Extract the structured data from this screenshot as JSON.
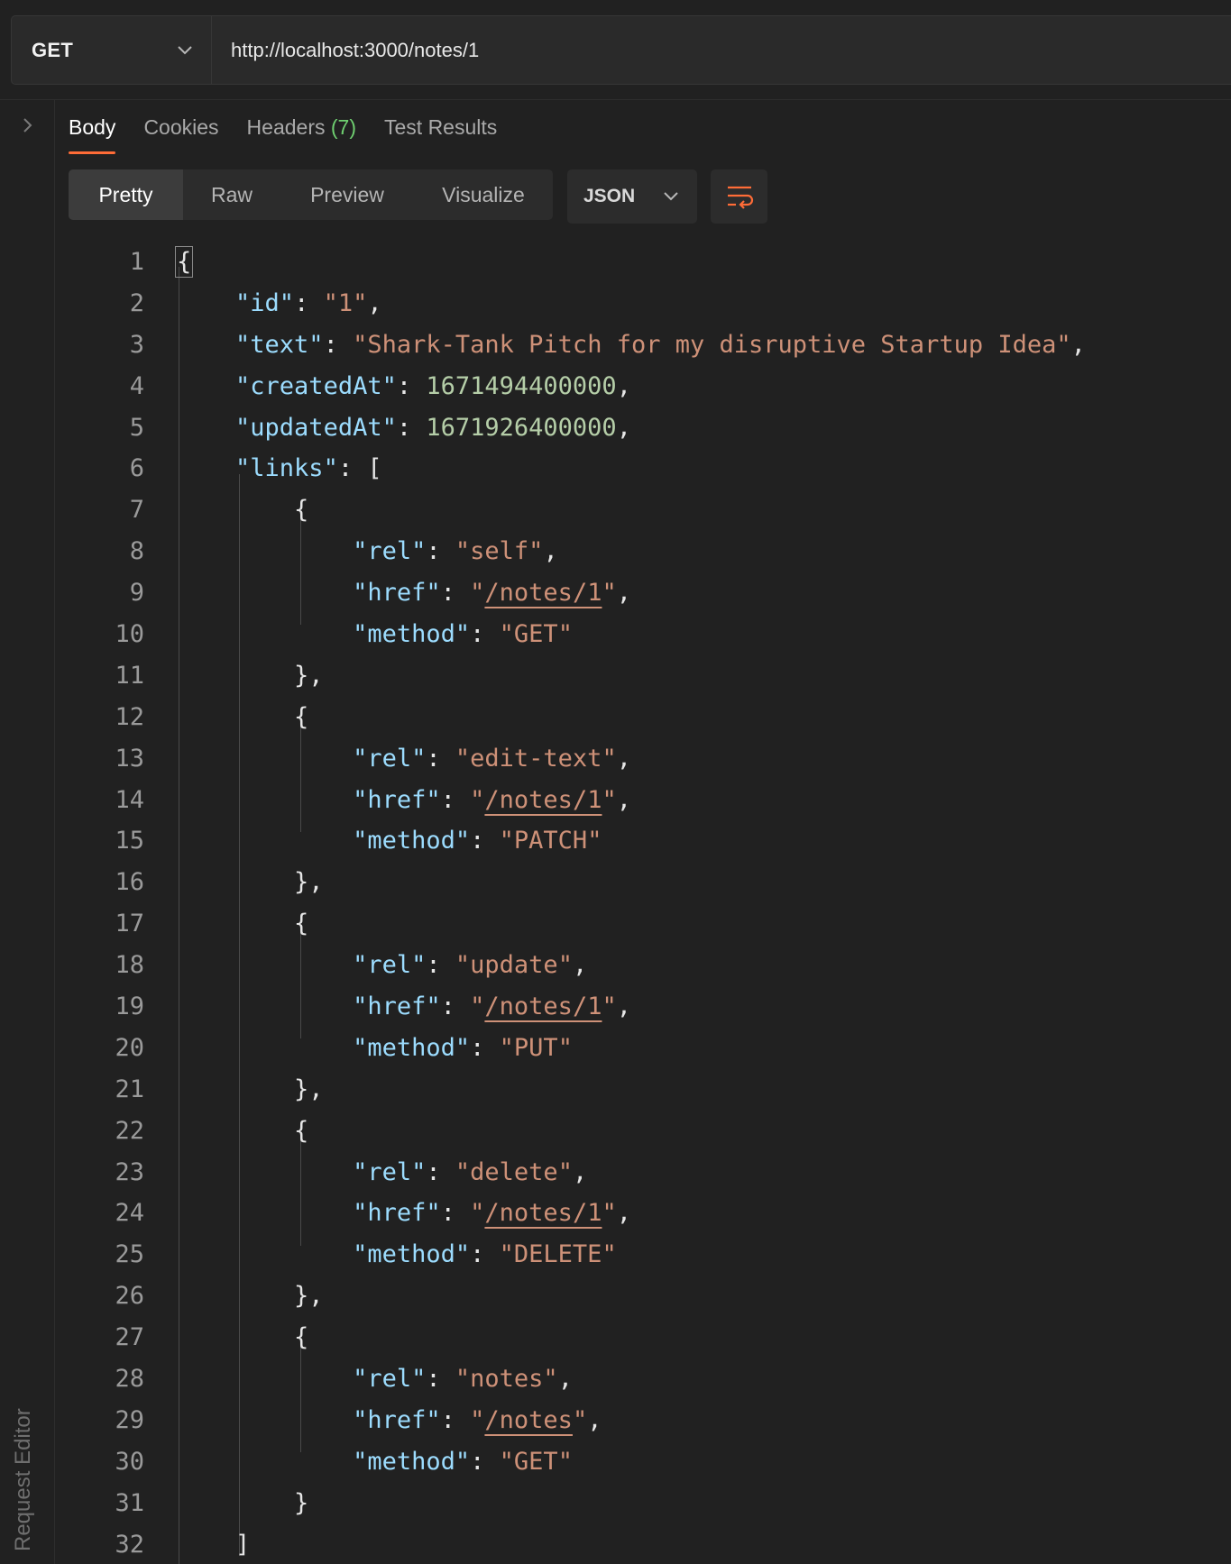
{
  "request": {
    "method": "GET",
    "url": "http://localhost:3000/notes/1"
  },
  "sidebar": {
    "label": "Request Editor"
  },
  "response_tabs": [
    {
      "label": "Body",
      "active": true
    },
    {
      "label": "Cookies"
    },
    {
      "label": "Headers",
      "count": "(7)"
    },
    {
      "label": "Test Results"
    }
  ],
  "view_modes": [
    "Pretty",
    "Raw",
    "Preview",
    "Visualize"
  ],
  "active_view": "Pretty",
  "format": "JSON",
  "icons": {
    "method_dropdown": "chevron-down-icon",
    "sidebar_toggle": "chevron-right-icon",
    "format_dropdown": "chevron-down-icon",
    "wrap": "wrap-lines-icon"
  },
  "colors": {
    "accent": "#ff6c37",
    "key": "#9cdcfe",
    "string": "#ce9178",
    "number": "#b5cea8",
    "count": "#6fcf70",
    "background": "#212121"
  },
  "code": {
    "line_numbers": [
      "1",
      "2",
      "3",
      "4",
      "5",
      "6",
      "7",
      "8",
      "9",
      "10",
      "11",
      "12",
      "13",
      "14",
      "15",
      "16",
      "17",
      "18",
      "19",
      "20",
      "21",
      "22",
      "23",
      "24",
      "25",
      "26",
      "27",
      "28",
      "29",
      "30",
      "31",
      "32"
    ],
    "body": {
      "id": "1",
      "text": "Shark-Tank Pitch for my disruptive Startup Idea",
      "createdAt": "1671494400000",
      "updatedAt": "1671926400000",
      "links": [
        {
          "rel": "self",
          "href": "/notes/1",
          "method": "GET"
        },
        {
          "rel": "edit-text",
          "href": "/notes/1",
          "method": "PATCH"
        },
        {
          "rel": "update",
          "href": "/notes/1",
          "method": "PUT"
        },
        {
          "rel": "delete",
          "href": "/notes/1",
          "method": "DELETE"
        },
        {
          "rel": "notes",
          "href": "/notes",
          "method": "GET"
        }
      ]
    }
  }
}
